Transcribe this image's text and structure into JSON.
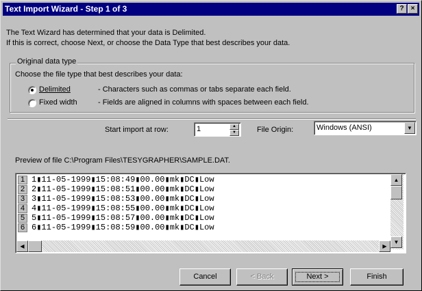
{
  "window": {
    "title": "Text Import Wizard - Step 1 of 3",
    "help_glyph": "?",
    "close_glyph": "×"
  },
  "intro": {
    "line1": "The Text Wizard has determined that your data is Delimited.",
    "line2": "If this is correct, choose Next, or choose the Data Type that best describes your data."
  },
  "original_data_type": {
    "legend": "Original data type",
    "prompt": "Choose the file type that best describes your data:",
    "options": [
      {
        "label": "Delimited",
        "description": "- Characters such as commas or tabs separate each field.",
        "selected": true
      },
      {
        "label": "Fixed width",
        "description": "- Fields are aligned in columns with spaces between each field.",
        "selected": false
      }
    ]
  },
  "import": {
    "start_row_label": "Start import at row:",
    "start_row_value": "1",
    "file_origin_label": "File Origin:",
    "file_origin_value": "Windows (ANSI)"
  },
  "preview": {
    "label": "Preview of file C:\\Program Files\\TESYGRAPHER\\SAMPLE.DAT.",
    "rows": [
      {
        "num": "1",
        "data": "1▮11-05-1999▮15:08:49▮00.00▮mk▮DC▮Low"
      },
      {
        "num": "2",
        "data": "2▮11-05-1999▮15:08:51▮00.00▮mk▮DC▮Low"
      },
      {
        "num": "3",
        "data": "3▮11-05-1999▮15:08:53▮00.00▮mk▮DC▮Low"
      },
      {
        "num": "4",
        "data": "4▮11-05-1999▮15:08:55▮00.00▮mk▮DC▮Low"
      },
      {
        "num": "5",
        "data": "5▮11-05-1999▮15:08:57▮00.00▮mk▮DC▮Low"
      },
      {
        "num": "6",
        "data": "6▮11-05-1999▮15:08:59▮00.00▮mk▮DC▮Low"
      }
    ]
  },
  "buttons": {
    "cancel": "Cancel",
    "back": "< Back",
    "next": "Next >",
    "finish": "Finish"
  }
}
